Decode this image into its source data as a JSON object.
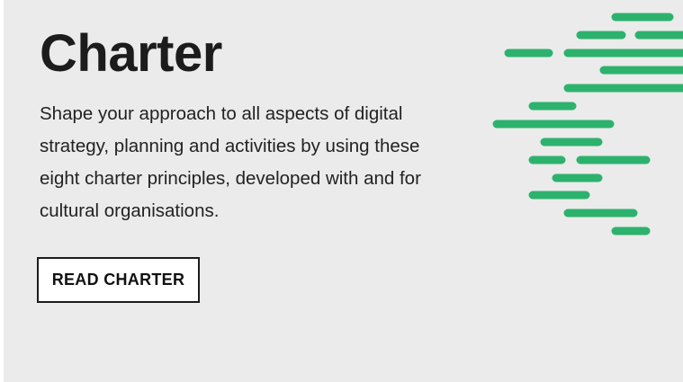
{
  "hero": {
    "title": "Charter",
    "description": "Shape your approach to all aspects of digital strategy, planning and activities by using these eight charter principles, developed with and for cultural organisations.",
    "cta_label": "READ CHARTER"
  },
  "colors": {
    "background": "#ebebeb",
    "accent": "#2db26e",
    "text": "#1c1c1c"
  },
  "decoration": {
    "icon": "green-dash-lines-graphic"
  }
}
